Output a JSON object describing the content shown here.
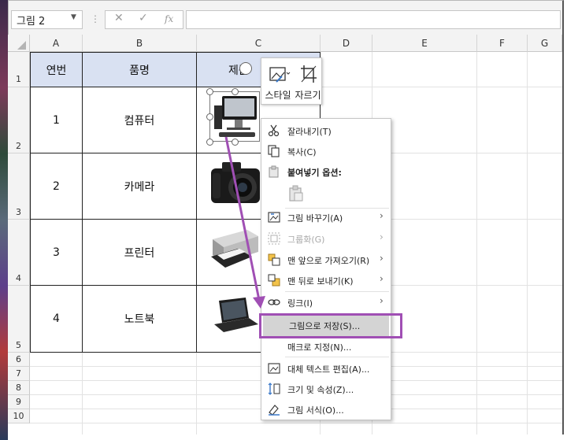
{
  "formula_bar": {
    "name_box": "그림 2",
    "cancel_glyph": "✕",
    "enter_glyph": "✓",
    "function_glyph": "fx",
    "formula_value": ""
  },
  "columns": [
    "A",
    "B",
    "C",
    "D",
    "E",
    "F",
    "G"
  ],
  "rows": [
    "1",
    "2",
    "3",
    "4",
    "5",
    "6",
    "7",
    "8",
    "9",
    "10"
  ],
  "table": {
    "headers": [
      "연번",
      "품명",
      "제품"
    ],
    "items": [
      {
        "no": "1",
        "name": "컴퓨터",
        "image": "computer-image"
      },
      {
        "no": "2",
        "name": "카메라",
        "image": "camera-image"
      },
      {
        "no": "3",
        "name": "프린터",
        "image": "printer-image"
      },
      {
        "no": "4",
        "name": "노트북",
        "image": "laptop-image"
      }
    ]
  },
  "mini_toolbar": {
    "style_label": "스타일",
    "crop_label": "자르기"
  },
  "context_menu": {
    "cut": "잘라내기(T)",
    "copy": "복사(C)",
    "paste_options": "붙여넣기 옵션:",
    "change_picture": "그림 바꾸기(A)",
    "group": "그룹화(G)",
    "bring_to_front": "맨 앞으로 가져오기(R)",
    "send_to_back": "맨 뒤로 보내기(K)",
    "link": "링크(I)",
    "save_as_picture": "그림으로 저장(S)...",
    "assign_macro": "매크로 지정(N)...",
    "edit_alt_text": "대체 텍스트 편집(A)...",
    "size_properties": "크기 및 속성(Z)...",
    "format_picture": "그림 서식(O)...",
    "submenu_glyph": "›"
  },
  "colors": {
    "header_fill": "#d9e1f2",
    "highlight": "#a04fb4",
    "menu_hover": "#d4d4d4"
  }
}
